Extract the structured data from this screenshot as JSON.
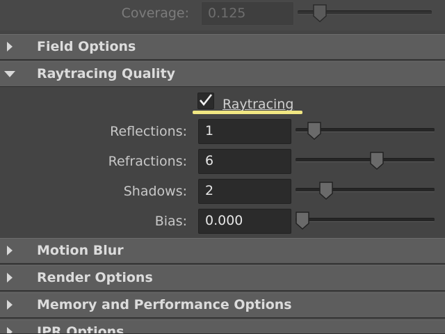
{
  "coverage": {
    "label": "Coverage:",
    "value": "0.125",
    "slider_fraction": 0.17
  },
  "sections": {
    "field_options": "Field Options",
    "raytracing_quality": "Raytracing Quality",
    "motion_blur": "Motion Blur",
    "render_options": "Render Options",
    "memory_performance": "Memory and Performance Options",
    "ipr_options": "IPR Options"
  },
  "raytracing": {
    "checkbox_label": "Raytracing",
    "checked": true,
    "reflections": {
      "label": "Reflections:",
      "value": "1",
      "slider_fraction": 0.13
    },
    "refractions": {
      "label": "Refractions:",
      "value": "6",
      "slider_fraction": 0.58
    },
    "shadows": {
      "label": "Shadows:",
      "value": "2",
      "slider_fraction": 0.22
    },
    "bias": {
      "label": "Bias:",
      "value": "0.000",
      "slider_fraction": 0.0
    }
  },
  "colors": {
    "highlight_underline": "#f0e682",
    "panel_bg": "#444444",
    "section_bg": "#5d5d5d"
  }
}
